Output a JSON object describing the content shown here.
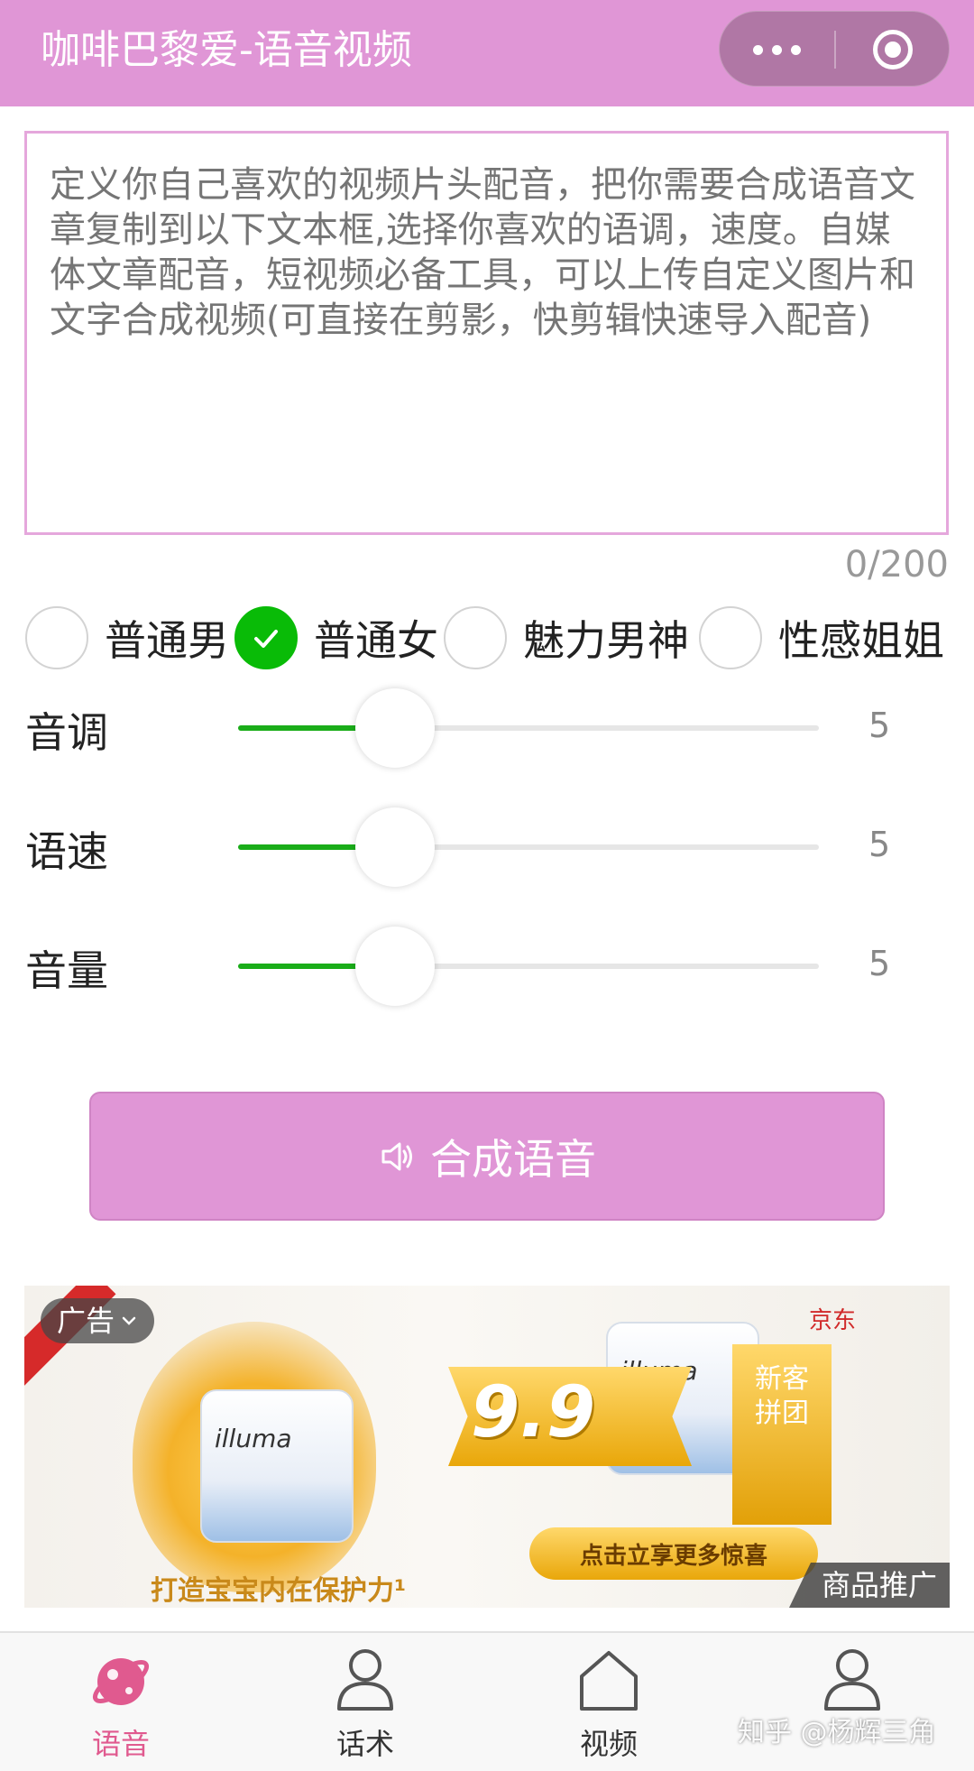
{
  "header": {
    "title": "咖啡巴黎爱-语音视频"
  },
  "editor": {
    "placeholder": "定义你自己喜欢的视频片头配音，把你需要合成语音文章复制到以下文本框,选择你喜欢的语调，速度。自媒体文章配音，短视频必备工具，可以上传自定义图片和文字合成视频(可直接在剪影，快剪辑快速导入配音)",
    "counter": "0/200"
  },
  "voices": [
    {
      "label": "普通男",
      "selected": false
    },
    {
      "label": "普通女",
      "selected": true
    },
    {
      "label": "魅力男神",
      "selected": false
    },
    {
      "label": "性感姐姐",
      "selected": false
    }
  ],
  "sliders": [
    {
      "label": "音调",
      "value": "5",
      "level": 0.27
    },
    {
      "label": "语速",
      "value": "5",
      "level": 0.27
    },
    {
      "label": "音量",
      "value": "5",
      "level": 0.27
    }
  ],
  "synth_button": {
    "label": "合成语音",
    "icon": "speaker-icon"
  },
  "ad": {
    "tag": "广告",
    "slogan": "打造宝宝内在保护力¹",
    "brand": "illuma",
    "store": "京东",
    "price": "9.9",
    "group_label": "新客拼团",
    "cta": "点击立享更多惊喜",
    "promo_label": "商品推广"
  },
  "tabbar": {
    "items": [
      {
        "label": "语音",
        "icon": "planet-icon",
        "active": true
      },
      {
        "label": "话术",
        "icon": "user-icon",
        "active": false
      },
      {
        "label": "视频",
        "icon": "home-icon",
        "active": false
      },
      {
        "label": "",
        "icon": "user-icon",
        "active": false
      }
    ]
  },
  "watermark": "知乎 @杨辉三角",
  "colors": {
    "accent": "#e096d6",
    "green": "#1aad19",
    "active_tab": "#e05a8f"
  }
}
